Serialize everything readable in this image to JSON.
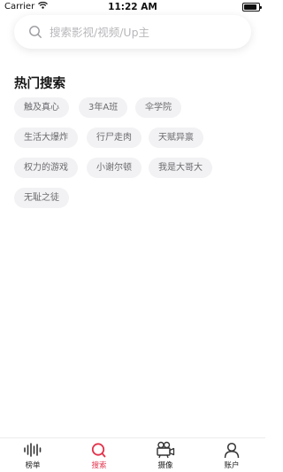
{
  "status_bar": {
    "carrier": "Carrier",
    "time": "11:22 AM",
    "battery_level": 0.85
  },
  "search": {
    "placeholder": "搜索影视/视频/Up主"
  },
  "hot_search": {
    "title": "热门搜索",
    "rows": [
      [
        "触及真心",
        "3年A班",
        "伞学院"
      ],
      [
        "生活大爆炸",
        "行尸走肉",
        "天赋异禀"
      ],
      [
        "权力的游戏",
        "小谢尔顿",
        "我是大哥大"
      ],
      [
        "无耻之徒"
      ]
    ]
  },
  "tab_bar": {
    "items": [
      {
        "label": "榜单",
        "icon": "waveform-icon",
        "active": false
      },
      {
        "label": "搜索",
        "icon": "search-icon",
        "active": true
      },
      {
        "label": "摄像",
        "icon": "camera-icon",
        "active": false
      },
      {
        "label": "账户",
        "icon": "user-icon",
        "active": false
      }
    ]
  },
  "colors": {
    "accent": "#e2334b",
    "tag_bg": "#f2f2f4",
    "tag_text": "#6b6b6f",
    "placeholder": "#b8b8bc"
  }
}
